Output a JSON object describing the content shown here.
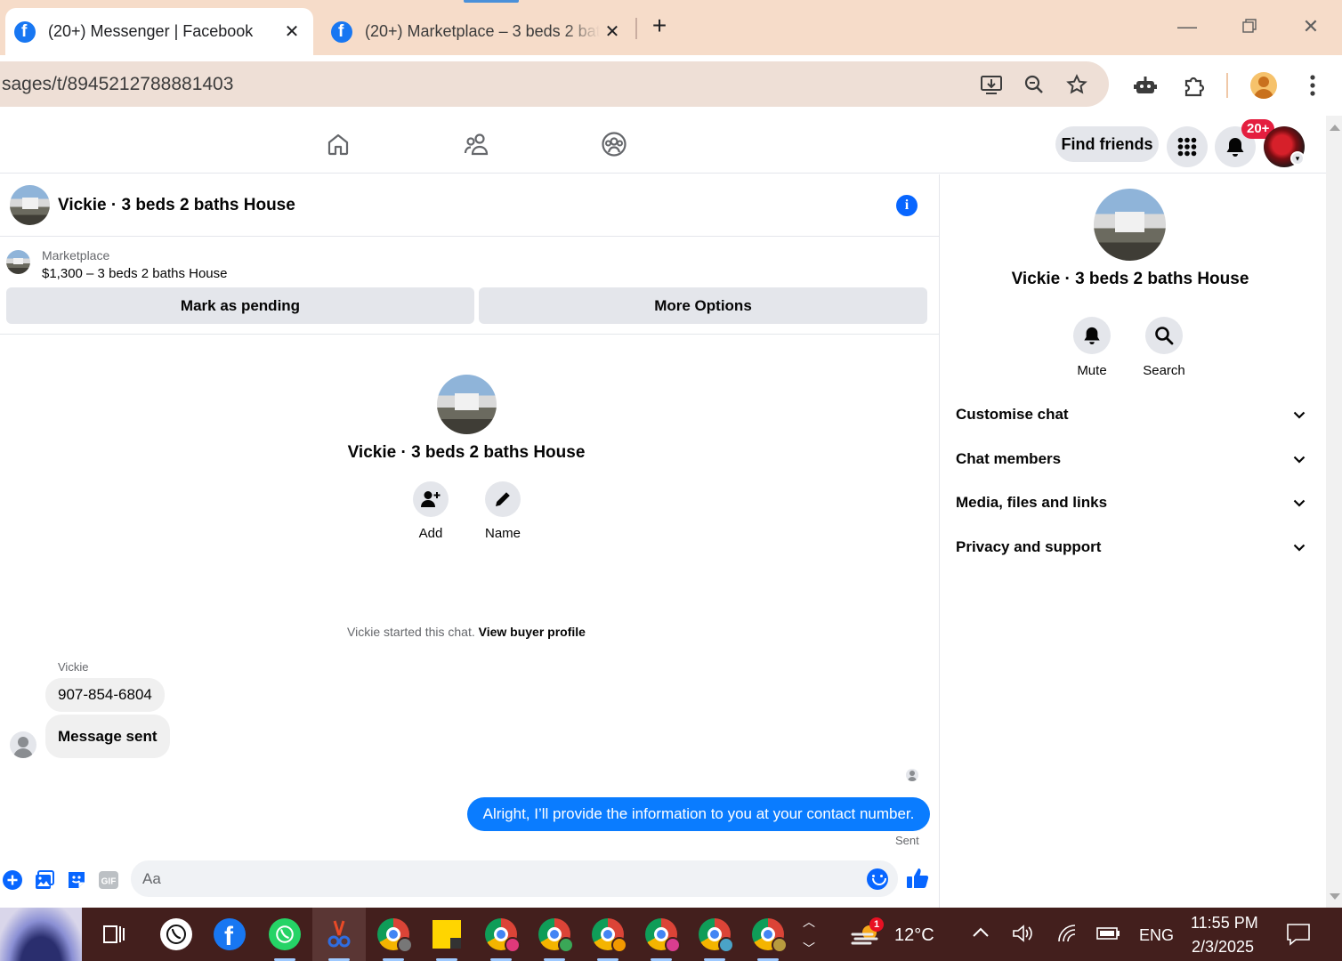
{
  "browser": {
    "tabs": [
      {
        "title": "(20+) Messenger | Facebook",
        "active": true
      },
      {
        "title": "(20+) Marketplace – 3 beds 2 baths House",
        "active": false
      }
    ],
    "address": "sages/t/8945212788881403",
    "window_controls": [
      "minimize",
      "restore",
      "close"
    ]
  },
  "fb_header": {
    "nav_icons": [
      "home-icon",
      "friends-icon",
      "groups-icon"
    ],
    "find_friends_label": "Find friends",
    "notification_badge": "20+"
  },
  "chat": {
    "title": "Vickie · 3 beds 2 baths House",
    "marketplace": {
      "label": "Marketplace",
      "listing": "$1,300 – 3 beds 2 baths House",
      "mark_pending_label": "Mark as pending",
      "more_options_label": "More Options"
    },
    "intro": {
      "name": "Vickie · 3 beds 2 baths House",
      "add_label": "Add",
      "name_label": "Name"
    },
    "started_text": "Vickie started this chat.",
    "view_buyer_profile": "View buyer profile",
    "sender_name": "Vickie",
    "messages_in": [
      "907-854-6804",
      "Message sent"
    ],
    "message_out": "Alright, I’ll provide the information to you at your contact number.",
    "sent_label": "Sent",
    "composer_placeholder": "Aa",
    "composer_icons": [
      "plus-icon",
      "photo-icon",
      "sticker-icon",
      "gif-icon",
      "emoji-icon",
      "like-icon"
    ],
    "gif_label": "GIF"
  },
  "side_panel": {
    "title": "Vickie · 3 beds 2 baths House",
    "mute_label": "Mute",
    "search_label": "Search",
    "sections": [
      "Customise chat",
      "Chat members",
      "Media, files and links",
      "Privacy and support"
    ]
  },
  "taskbar": {
    "weather_temp": "12°C",
    "weather_badge": "1",
    "language": "ENG",
    "time": "11:55 PM",
    "date": "2/3/2025"
  },
  "colors": {
    "fb_blue": "#0866ff",
    "outgoing_bubble": "#0a7cff",
    "tabbar_bg": "#f6dcc9",
    "taskbar_bg": "#431f1d",
    "badge_red": "#e41e3f"
  }
}
